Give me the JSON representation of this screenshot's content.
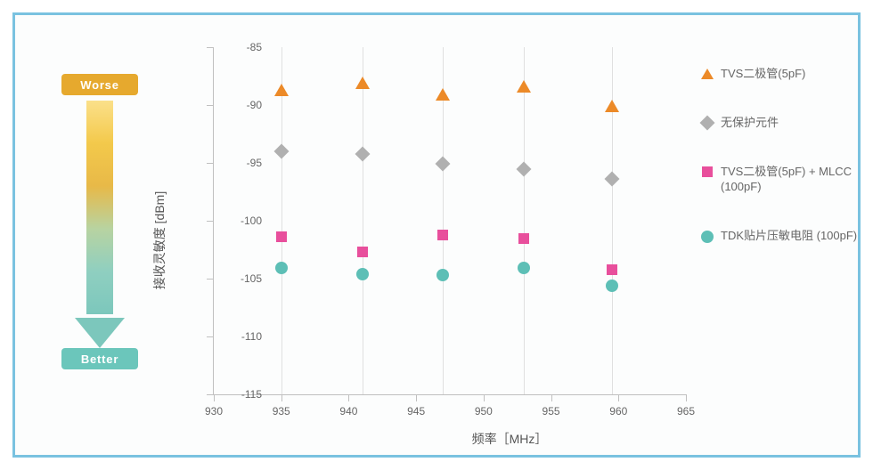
{
  "arrow": {
    "worse": "Worse",
    "better": "Better"
  },
  "chart": {
    "ylabel": "接收灵敏度 [dBm]",
    "xlabel": "频率［MHz］"
  },
  "yticks": [
    "-85",
    "-90",
    "-95",
    "-100",
    "-105",
    "-110",
    "-115"
  ],
  "xticks": [
    "930",
    "935",
    "940",
    "945",
    "950",
    "955",
    "960",
    "965"
  ],
  "legend": [
    {
      "label": "TVS二极管(5pF)"
    },
    {
      "label": "无保护元件"
    },
    {
      "label": "TVS二极管(5pF) + MLCC (100pF)"
    },
    {
      "label": "TDK贴片压敏电阻 (100pF)"
    }
  ],
  "chart_data": {
    "type": "scatter",
    "xlabel": "频率［MHz］",
    "ylabel": "接收灵敏度 [dBm]",
    "xlim": [
      930,
      965
    ],
    "ylim": [
      -115,
      -85
    ],
    "x": [
      935,
      941,
      947,
      953,
      959.5
    ],
    "series": [
      {
        "name": "TVS二极管(5pF)",
        "marker": "triangle",
        "color": "#ec8a28",
        "values": [
          -88.7,
          -88.1,
          -89.1,
          -88.4,
          -90.1
        ]
      },
      {
        "name": "无保护元件",
        "marker": "diamond",
        "color": "#b0b0b0",
        "values": [
          -94.0,
          -94.2,
          -95.1,
          -95.5,
          -96.4
        ]
      },
      {
        "name": "TVS二极管(5pF) + MLCC (100pF)",
        "marker": "square",
        "color": "#e84f9c",
        "values": [
          -101.4,
          -102.7,
          -101.2,
          -101.5,
          -104.2
        ]
      },
      {
        "name": "TDK贴片压敏电阻 (100pF)",
        "marker": "circle",
        "color": "#5dbfb6",
        "values": [
          -104.1,
          -104.6,
          -104.7,
          -104.1,
          -105.6
        ]
      }
    ]
  }
}
